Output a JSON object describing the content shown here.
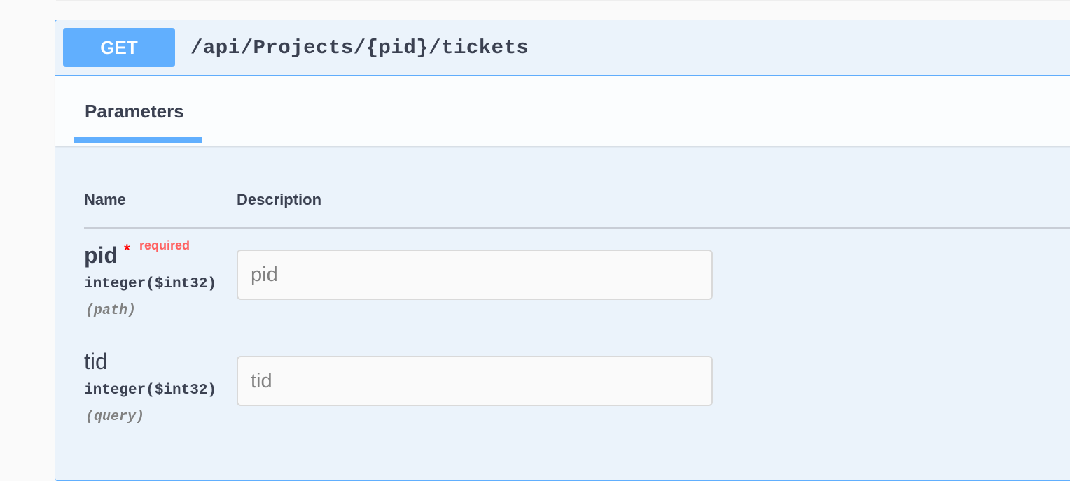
{
  "operation": {
    "method": "GET",
    "path": "/api/Projects/{pid}/tickets"
  },
  "tabs": [
    {
      "label": "Parameters",
      "active": true
    }
  ],
  "columns": {
    "name": "Name",
    "description": "Description"
  },
  "parameters": [
    {
      "name": "pid",
      "required": true,
      "required_marker": "*",
      "required_label": "required",
      "type": "integer($int32)",
      "location": "(path)",
      "value": "",
      "placeholder": "pid"
    },
    {
      "name": "tid",
      "required": false,
      "type": "integer($int32)",
      "location": "(query)",
      "value": "",
      "placeholder": "tid"
    }
  ],
  "colors": {
    "get_accent": "#61affe",
    "block_background": "#ebf3fb",
    "required_text": "#ff6060",
    "asterisk": "#ff0000"
  }
}
